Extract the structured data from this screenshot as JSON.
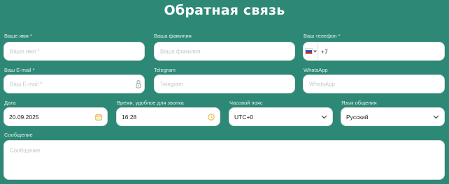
{
  "form": {
    "title": "Обратная связь",
    "first_name": {
      "label": "Ваше имя *",
      "placeholder": "Ваше имя *"
    },
    "last_name": {
      "label": "Ваша фамилия",
      "placeholder": "Ваша фамилия"
    },
    "phone": {
      "label": "Ваш телефон *",
      "value": "+7",
      "flag": "ru-flag"
    },
    "email": {
      "label": "Ваш E-mail *",
      "placeholder": "Ваш E-mail *"
    },
    "telegram": {
      "label": "Telegram",
      "placeholder": "Telegram"
    },
    "whatsapp": {
      "label": "WhatsApp",
      "placeholder": "WhatsApp"
    },
    "date": {
      "label": "Дата",
      "value": "20.09.2025"
    },
    "call_time": {
      "label": "Время, удобное для звонка",
      "value": "16:28"
    },
    "timezone": {
      "label": "Часовой пояс",
      "value": "UTC+0"
    },
    "language": {
      "label": "Язык общения",
      "value": "Русский"
    },
    "message": {
      "label": "Сообщение",
      "placeholder": "Сообщение"
    }
  },
  "colors": {
    "background": "#2e8876",
    "field": "#ffffff",
    "icon_accent": "#e3b341"
  }
}
